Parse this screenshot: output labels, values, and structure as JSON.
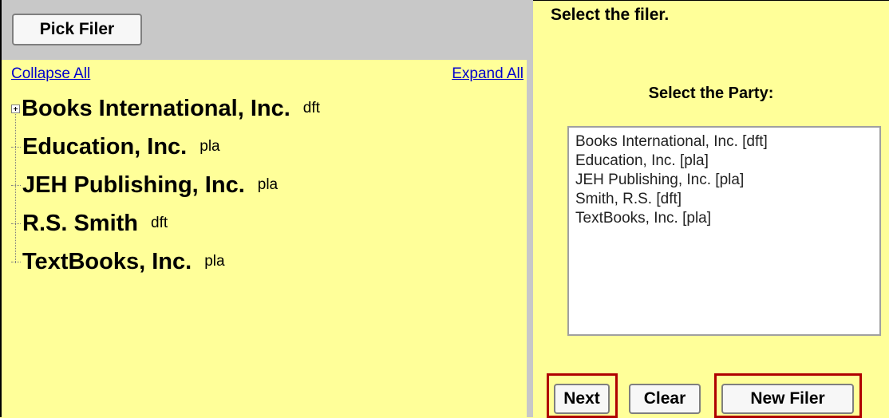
{
  "left_pane": {
    "pick_filer_label": "Pick Filer",
    "collapse_all_label": "Collapse All",
    "expand_all_label": "Expand All",
    "tree_items": [
      {
        "name": "Books International, Inc.",
        "role": "dft",
        "expandable": true
      },
      {
        "name": "Education, Inc.",
        "role": "pla",
        "expandable": false
      },
      {
        "name": "JEH Publishing, Inc.",
        "role": "pla",
        "expandable": false
      },
      {
        "name": "R.S. Smith",
        "role": "dft",
        "expandable": false
      },
      {
        "name": "TextBooks, Inc.",
        "role": "pla",
        "expandable": false
      }
    ]
  },
  "right_pane": {
    "instruction": "Select the filer.",
    "party_label": "Select the Party:",
    "party_options": [
      "Books International, Inc.  [dft]",
      "Education, Inc.  [pla]",
      "JEH Publishing, Inc.  [pla]",
      "Smith, R.S.  [dft]",
      "TextBooks, Inc.  [pla]"
    ],
    "buttons": {
      "next": "Next",
      "clear": "Clear",
      "new_filer": "New Filer"
    }
  },
  "colors": {
    "panel_background": "#ffff99",
    "toolbar_gray": "#c8c8c8",
    "link_blue": "#0000cc",
    "highlight_red": "#b00000"
  }
}
